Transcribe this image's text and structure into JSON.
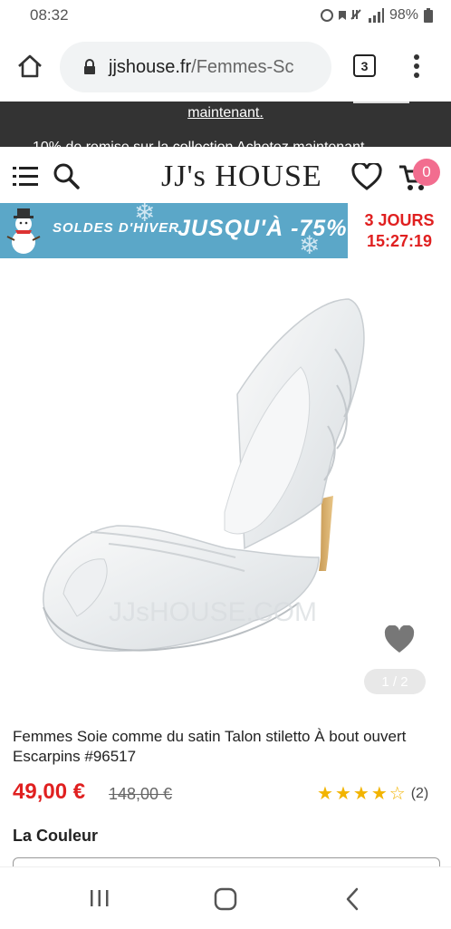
{
  "status_bar": {
    "time": "08:32",
    "battery": "98%"
  },
  "browser": {
    "url_domain": "jjshouse.fr",
    "url_path": "/Femmes-Sc",
    "tab_count": "3"
  },
  "promo": {
    "line1": "maintenant.",
    "line2": "10% de remise sur la collection Achetez maintenant"
  },
  "header": {
    "logo": "JJ's HOUSE",
    "cart_count": "0"
  },
  "banner": {
    "soldes": "SOLDES D'HIVER",
    "jusqua": "JUSQU'À -75%",
    "jours": "3 JOURS",
    "countdown": "15:27:19"
  },
  "gallery": {
    "pager": "1 / 2",
    "watermark": "JJsHOUSE.COM"
  },
  "product": {
    "title": "Femmes Soie comme du satin Talon stiletto À bout ouvert Escarpins #96517",
    "price": "49,00 €",
    "old_price": "148,00 €",
    "rating": 4,
    "review_count": "(2)",
    "color_label": "La Couleur"
  },
  "colors": {
    "accent": "#e02020",
    "badge": "#f26d8f",
    "banner": "#5ba7c8",
    "star": "#f2b400"
  }
}
